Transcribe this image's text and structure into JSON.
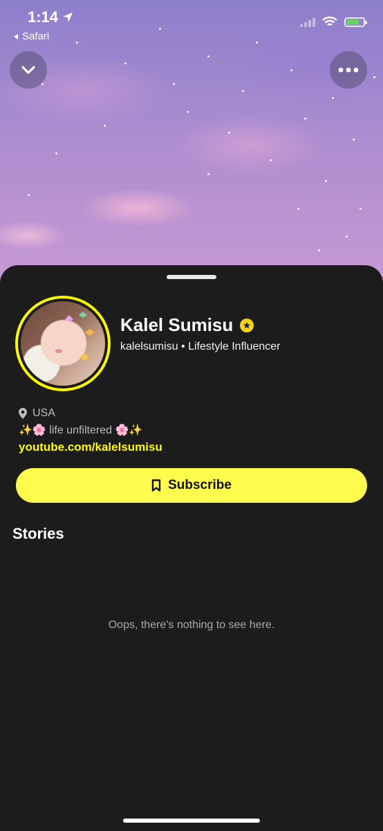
{
  "status_bar": {
    "time": "1:14",
    "back_app": "Safari"
  },
  "profile": {
    "name": "Kalel Sumisu",
    "subtitle": "kalelsumisu • Lifestyle Influencer",
    "location": "USA",
    "bio": "✨🌸 life unfiltered 🌸✨",
    "link": "youtube.com/kalelsumisu",
    "subscribe_label": "Subscribe"
  },
  "stories": {
    "heading": "Stories",
    "empty_message": "Oops, there's nothing to see here."
  },
  "colors": {
    "accent": "#fffc00",
    "button": "#fffc4e",
    "sheet_bg": "#1c1c1c",
    "verified": "#f5d31c"
  },
  "icons": [
    "location-arrow-icon",
    "signal-icon",
    "wifi-icon",
    "battery-icon",
    "chevron-down-icon",
    "more-icon",
    "verified-star-icon",
    "location-pin-icon",
    "bookmark-icon"
  ]
}
